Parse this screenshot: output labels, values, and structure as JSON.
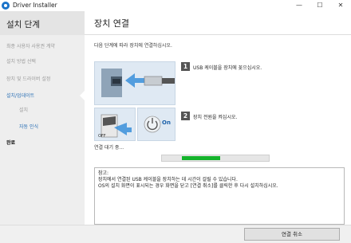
{
  "window": {
    "title": "Driver Installer",
    "minimize_glyph": "—",
    "maximize_glyph": "☐",
    "close_glyph": "✕"
  },
  "sidebar": {
    "title": "설치 단계",
    "items": [
      {
        "label": "최종 사용자 사용권 계약",
        "state": "done"
      },
      {
        "label": "설치 방법 선택",
        "state": "done"
      },
      {
        "label": "장치 및 드라이버 설정",
        "state": "done"
      },
      {
        "label": "설치/업데이트",
        "state": "active"
      },
      {
        "label": "설치",
        "state": "done"
      },
      {
        "label": "자동 인식",
        "state": "active"
      },
      {
        "label": "완료",
        "state": "current"
      }
    ]
  },
  "main": {
    "title": "장치 연결",
    "instruction": "다음 단계에 따라 장치에 연결하십시오.",
    "steps": [
      {
        "number": "1",
        "text": "USB 케이블을 장치에 꽂으십시오."
      },
      {
        "number": "2",
        "text": "장치 전원을 켜십시오."
      }
    ],
    "illustration_labels": {
      "off": "OFF",
      "on": "On"
    },
    "wait_text": "연결 대기 중...",
    "progress": {
      "fraction": 0.36,
      "offset_fraction": 0.19
    },
    "note_lines": [
      "참고:",
      "장치에서 연결된 USB 케이블을 장치하는 데 시간이 걸릴 수 있습니다.",
      "OS의 설치 화면이 표시되는 경우 화면을 닫고 [연결 취소]를 클릭한 후 다시 설치하십시오."
    ]
  },
  "footer": {
    "cancel_label": "연결 취소"
  },
  "colors": {
    "accent": "#2a6fb5",
    "progress": "#14b32b",
    "sidebar_bg": "#eeeeee"
  }
}
